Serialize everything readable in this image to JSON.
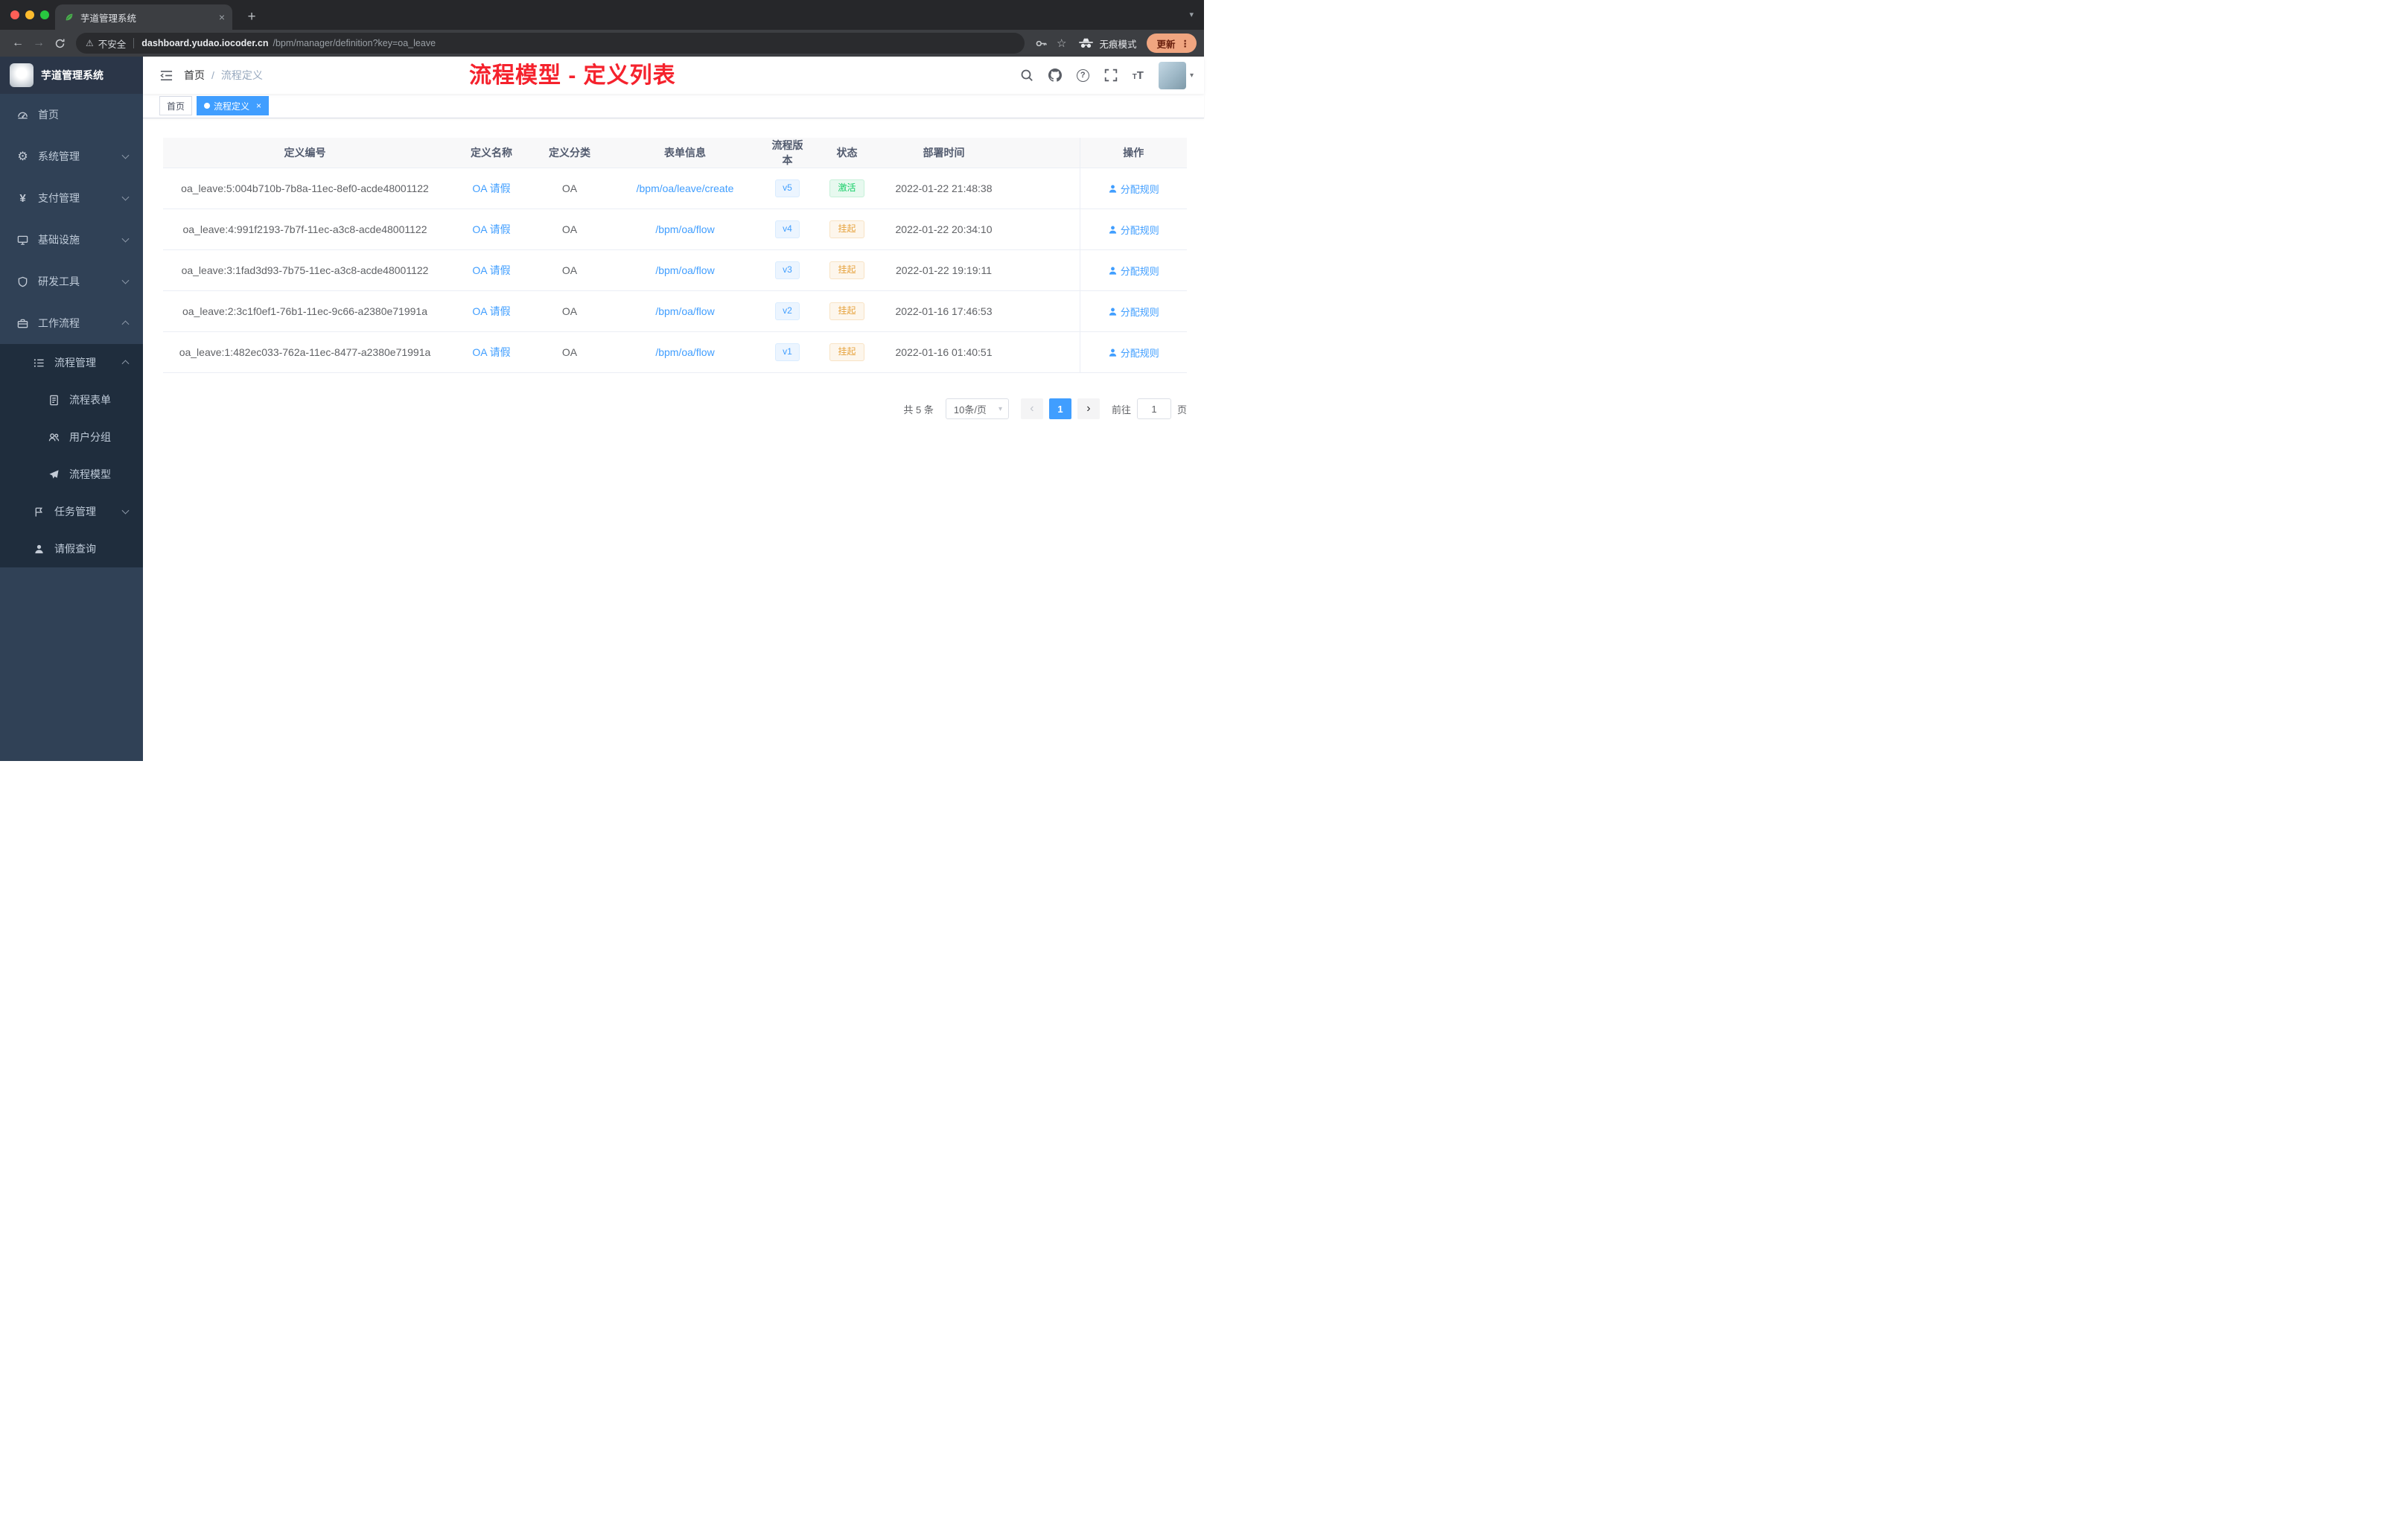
{
  "browser": {
    "tab_title": "芋道管理系统",
    "security_label": "不安全",
    "url_host": "dashboard.yudao.iocoder.cn",
    "url_path": "/bpm/manager/definition?key=oa_leave",
    "incognito_label": "无痕模式",
    "update_label": "更新"
  },
  "sidebar": {
    "logo_title": "芋道管理系统",
    "items": [
      {
        "label": "首页"
      },
      {
        "label": "系统管理"
      },
      {
        "label": "支付管理"
      },
      {
        "label": "基础设施"
      },
      {
        "label": "研发工具"
      },
      {
        "label": "工作流程"
      },
      {
        "label": "流程管理"
      },
      {
        "label": "流程表单"
      },
      {
        "label": "用户分组"
      },
      {
        "label": "流程模型"
      },
      {
        "label": "任务管理"
      },
      {
        "label": "请假查询"
      }
    ]
  },
  "header": {
    "breadcrumb_home": "首页",
    "breadcrumb_sep": "/",
    "breadcrumb_current": "流程定义",
    "annotation": "流程模型 - 定义列表"
  },
  "tags": {
    "home": "首页",
    "current": "流程定义"
  },
  "table": {
    "columns": [
      "定义编号",
      "定义名称",
      "定义分类",
      "表单信息",
      "流程版本",
      "状态",
      "部署时间",
      "操作"
    ],
    "rows": [
      {
        "id": "oa_leave:5:004b710b-7b8a-11ec-8ef0-acde48001122",
        "name": "OA 请假",
        "category": "OA",
        "form": "/bpm/oa/leave/create",
        "version": "v5",
        "status": "激活",
        "status_type": "active",
        "deploy_time": "2022-01-22 21:48:38",
        "action": "分配规则"
      },
      {
        "id": "oa_leave:4:991f2193-7b7f-11ec-a3c8-acde48001122",
        "name": "OA 请假",
        "category": "OA",
        "form": "/bpm/oa/flow",
        "version": "v4",
        "status": "挂起",
        "status_type": "suspended",
        "deploy_time": "2022-01-22 20:34:10",
        "action": "分配规则"
      },
      {
        "id": "oa_leave:3:1fad3d93-7b75-11ec-a3c8-acde48001122",
        "name": "OA 请假",
        "category": "OA",
        "form": "/bpm/oa/flow",
        "version": "v3",
        "status": "挂起",
        "status_type": "suspended",
        "deploy_time": "2022-01-22 19:19:11",
        "action": "分配规则"
      },
      {
        "id": "oa_leave:2:3c1f0ef1-76b1-11ec-9c66-a2380e71991a",
        "name": "OA 请假",
        "category": "OA",
        "form": "/bpm/oa/flow",
        "version": "v2",
        "status": "挂起",
        "status_type": "suspended",
        "deploy_time": "2022-01-16 17:46:53",
        "action": "分配规则"
      },
      {
        "id": "oa_leave:1:482ec033-762a-11ec-8477-a2380e71991a",
        "name": "OA 请假",
        "category": "OA",
        "form": "/bpm/oa/flow",
        "version": "v1",
        "status": "挂起",
        "status_type": "suspended",
        "deploy_time": "2022-01-16 01:40:51",
        "action": "分配规则"
      }
    ]
  },
  "pagination": {
    "total": "共 5 条",
    "page_size": "10条/页",
    "current_page": "1",
    "goto_label": "前往",
    "goto_value": "1",
    "goto_unit": "页"
  },
  "colors": {
    "accent": "#409eff",
    "annotation_red": "#f5222d",
    "status_active": "#13ce66",
    "status_suspended": "#e6a23c",
    "sidebar_bg": "#304156",
    "submenu_bg": "#1f2d3d"
  }
}
